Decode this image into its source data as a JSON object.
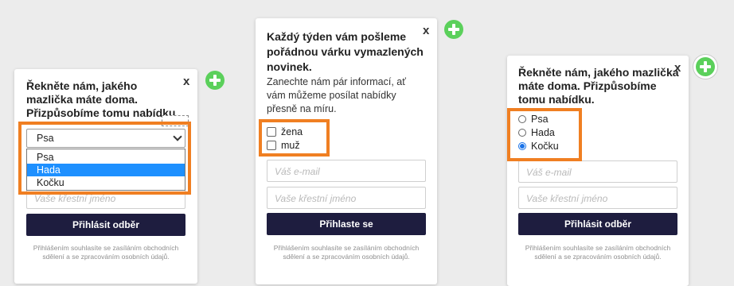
{
  "popup1": {
    "title": "Řekněte nám, jakého mazlička máte doma. Přizpůsobíme tomu nabídku.",
    "close": "x",
    "select_value": "Psa",
    "options": [
      "Psa",
      "Hada",
      "Kočku"
    ],
    "selected_option": "Hada",
    "name_placeholder": "Vaše křestní jméno",
    "button": "Přihlásit odběr",
    "fine_print": "Přihlášením souhlasíte se zasíláním obchodních sdělení a se zpracováním osobních údajů."
  },
  "popup2": {
    "title": "Každý týden vám pošleme pořádnou várku vymazlených novinek.",
    "close": "x",
    "description": "Zanechte nám pár informací, ať vám můžeme posílat nabídky přesně na míru.",
    "checkboxes": [
      "žena",
      "muž"
    ],
    "email_placeholder": "Váš e-mail",
    "name_placeholder": "Vaše křestní jméno",
    "button": "Přihlaste se",
    "fine_print": "Přihlášením souhlasíte se zasíláním obchodních sdělení a se zpracováním osobních údajů."
  },
  "popup3": {
    "title": "Řekněte nám, jakého mazlička máte doma. Přizpůsobíme tomu nabídku.",
    "close": "x",
    "radios": [
      "Psa",
      "Hada",
      "Kočku"
    ],
    "selected_radio": "Kočku",
    "email_placeholder": "Váš e-mail",
    "name_placeholder": "Vaše křestní jméno",
    "button": "Přihlásit odběr",
    "fine_print": "Přihlášením souhlasíte se zasíláním obchodních sdělení a se zpracováním osobních údajů."
  },
  "colors": {
    "highlight": "#f07f22",
    "button": "#1e1d3f",
    "add_icon": "#5bd05b",
    "selected_option": "#1e90ff"
  },
  "icons": [
    "close-icon",
    "add-icon",
    "chevron-down-icon"
  ]
}
